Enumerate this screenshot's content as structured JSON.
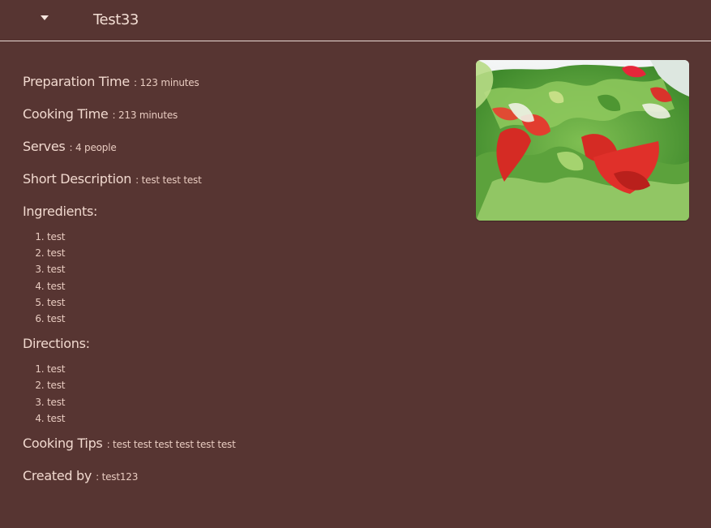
{
  "header": {
    "title": "Test33",
    "menu_icon": "caret-down-icon"
  },
  "recipe": {
    "preparation_time": {
      "label": "Preparation Time",
      "value": "123 minutes"
    },
    "cooking_time": {
      "label": "Cooking Time",
      "value": "213 minutes"
    },
    "serves": {
      "label": "Serves",
      "value": "4 people"
    },
    "short_description": {
      "label": "Short Description",
      "value": "test test test"
    },
    "ingredients": {
      "label": "Ingredients:",
      "items": [
        "test",
        "test",
        "test",
        "test",
        "test",
        "test"
      ]
    },
    "directions": {
      "label": "Directions:",
      "items": [
        "test",
        "test",
        "test",
        "test"
      ]
    },
    "cooking_tips": {
      "label": "Cooking Tips",
      "value": "test test test test test test"
    },
    "created_by": {
      "label": "Created by",
      "value": "test123"
    }
  },
  "image": {
    "alt": "salad-photo",
    "colors": {
      "lettuce": "#5fa640",
      "lettuce_light": "#9fcf6b",
      "tomato": "#d52b24",
      "plate": "#e9eef0"
    }
  },
  "colors": {
    "background": "#573532",
    "text": "#f2d9cf",
    "divider": "#e8d8d2"
  }
}
